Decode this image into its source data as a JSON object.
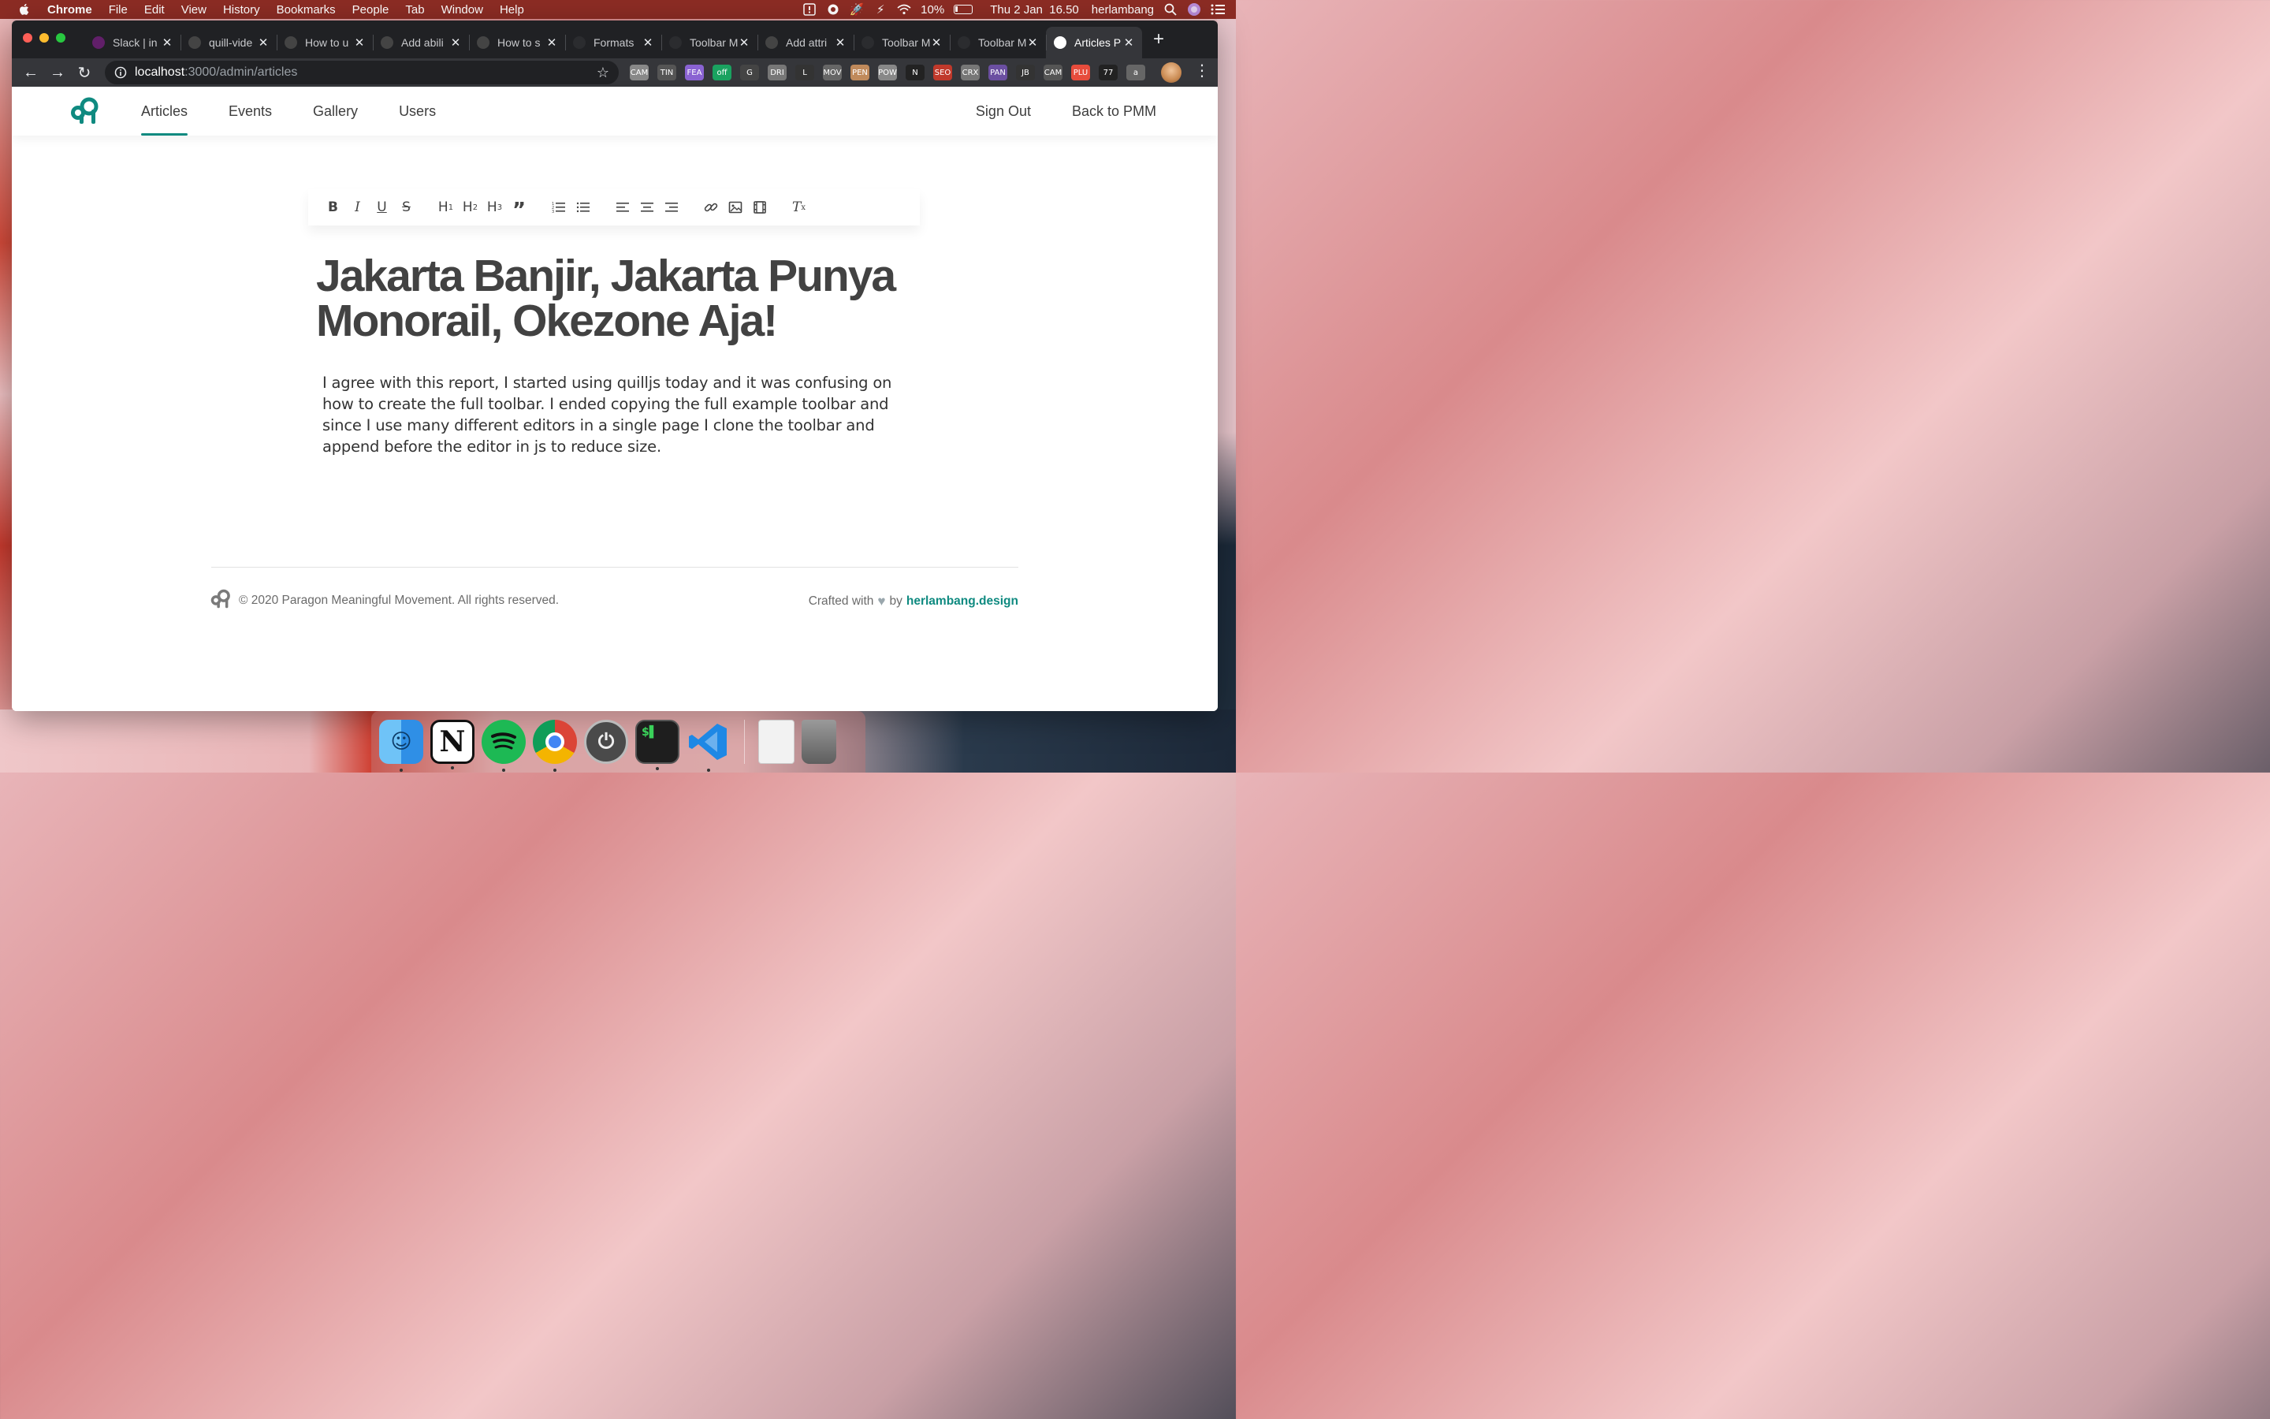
{
  "menubar": {
    "app": "Chrome",
    "menus": [
      "File",
      "Edit",
      "View",
      "History",
      "Bookmarks",
      "People",
      "Tab",
      "Window",
      "Help"
    ],
    "battery": "10%",
    "datetime": "Thu 2 Jan  16.50",
    "user": "herlambang"
  },
  "browser": {
    "tabs": [
      {
        "title": "Slack | in",
        "favicon_color": "#611f69"
      },
      {
        "title": "quill-vide",
        "favicon_color": "#444"
      },
      {
        "title": "How to u",
        "favicon_color": "#444"
      },
      {
        "title": "Add abili",
        "favicon_color": "#444"
      },
      {
        "title": "How to s",
        "favicon_color": "#444"
      },
      {
        "title": "Formats",
        "favicon_color": "#2b2c2f"
      },
      {
        "title": "Toolbar M",
        "favicon_color": "#2b2c2f"
      },
      {
        "title": "Add attri",
        "favicon_color": "#444"
      },
      {
        "title": "Toolbar M",
        "favicon_color": "#2b2c2f"
      },
      {
        "title": "Toolbar M",
        "favicon_color": "#2b2c2f"
      },
      {
        "title": "Articles P",
        "favicon_color": "#ffffff"
      }
    ],
    "url_host": "localhost",
    "url_path": ":3000/admin/articles",
    "extensions": [
      "camera",
      "TINY MCE",
      "feather",
      "off",
      "G",
      "drive",
      "L",
      "move",
      "pencil",
      "power",
      "N",
      "SEO",
      "CRX",
      "panther",
      "JB",
      "camera-off",
      "plus",
      "77",
      "a"
    ]
  },
  "site": {
    "nav": [
      "Articles",
      "Events",
      "Gallery",
      "Users"
    ],
    "nav_right": [
      "Sign Out",
      "Back to PMM"
    ],
    "brand_color": "#0f8a80"
  },
  "editor": {
    "title": "Jakarta Banjir, Jakarta Punya Monorail, Okezone Aja!",
    "body": "I agree with this report, I started using quilljs today and it was confusing on how to create the full toolbar. I ended copying the full example toolbar and since I use many different editors in a single page I clone the toolbar and append before the editor in js to reduce size."
  },
  "footer": {
    "copyright": "© 2020 Paragon Meaningful Movement. All rights reserved.",
    "crafted": "Crafted with",
    "by": "by",
    "brand": "herlambang.design"
  },
  "dock": [
    "Finder",
    "Notion",
    "Spotify",
    "Chrome",
    "Shutdown",
    "Terminal",
    "VS Code",
    "Documents",
    "Trash"
  ]
}
